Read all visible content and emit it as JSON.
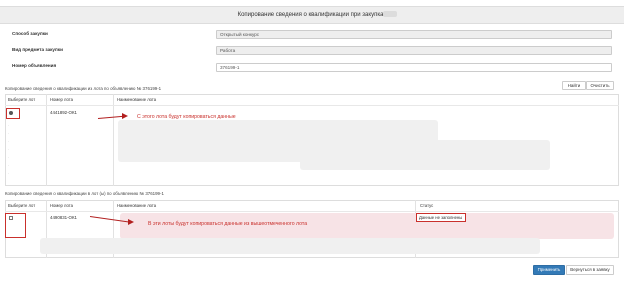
{
  "header": {
    "title": "Копирование сведения о квалификации при закупках"
  },
  "form": {
    "method_label": "Способ закупки",
    "method_value": "Открытый конкурс",
    "subject_label": "Вид предмета закупки",
    "subject_value": "Работа",
    "number_label": "Номер объявления",
    "number_value": "376199-1"
  },
  "source_section": {
    "caption": "Копирование сведения о квалификации из лота по объявлению № 376199-1",
    "find_label": "Найти",
    "clear_label": "Очистить",
    "columns": [
      "Выберите лот",
      "Номер лота",
      "Наименование лота"
    ],
    "row": {
      "lot_number": "4441892-ОК1"
    },
    "annotation": "С этого лота будут копироваться данные"
  },
  "target_section": {
    "caption": "Копирование сведения о квалификации в лот (ы) по объявлению № 376199-1",
    "columns": [
      "Выберите лот",
      "Номер лота",
      "Наименование лота",
      "Статус"
    ],
    "row": {
      "lot_number": "4490831-ОК1",
      "status": "Данные не заполнены"
    },
    "annotation": "В эти лоты будут копироваться данные из вышеотмеченного лота"
  },
  "footer": {
    "apply_label": "Применить",
    "back_label": "Вернуться в заявку"
  },
  "colors": {
    "primary": "#337ab7",
    "annotation_red": "#c9302c",
    "header_bg": "#eeeeee"
  }
}
